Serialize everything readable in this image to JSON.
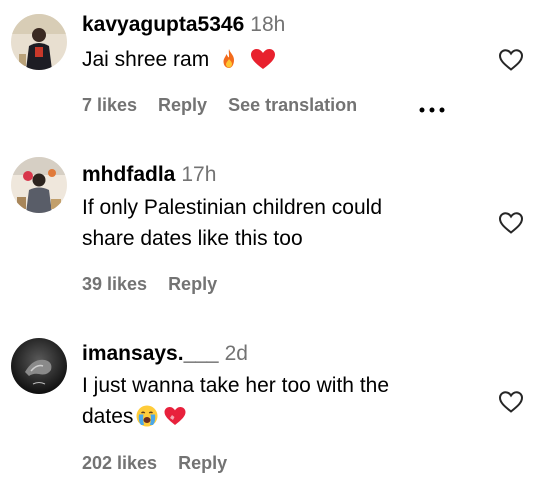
{
  "comments": [
    {
      "username": "kavyagupta5346",
      "time": "18h",
      "text": "Jai shree ram",
      "emojis": [
        "fire-emoji",
        "red-heart-emoji"
      ],
      "likes": "7 likes",
      "reply": "Reply",
      "translate": "See translation"
    },
    {
      "username": "mhdfadla",
      "time": "17h",
      "text_line1": "If only Palestinian children could",
      "text_line2": "share dates like this too",
      "likes": "39 likes",
      "reply": "Reply"
    },
    {
      "username": "imansays.___",
      "time": "2d",
      "text_line1": "I just wanna take her too with the",
      "text_line2": "dates",
      "emojis": [
        "crying-face-emoji",
        "heart-emoji"
      ],
      "likes": "202 likes",
      "reply": "Reply"
    }
  ],
  "colors": {
    "secondary_text": "#737373",
    "primary_text": "#000000",
    "background": "#ffffff"
  },
  "icons": [
    "heart-outline-icon",
    "more-options-icon"
  ]
}
